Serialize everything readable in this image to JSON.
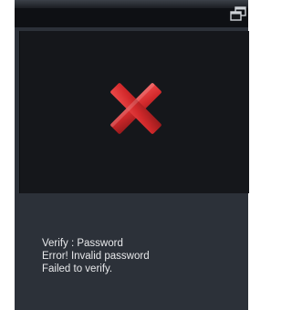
{
  "titlebar": {
    "icon": "window-restore-icon"
  },
  "result": {
    "icon": "error-x-icon",
    "icon_color": "#d2292b"
  },
  "status": {
    "lines": [
      "Verify : Password",
      "Error! Invalid password",
      "Failed to verify."
    ]
  },
  "colors": {
    "panel": "#2c3139",
    "image_frame": "#15171b",
    "titlebar": "#0e1014",
    "text": "#e8e9eb"
  }
}
